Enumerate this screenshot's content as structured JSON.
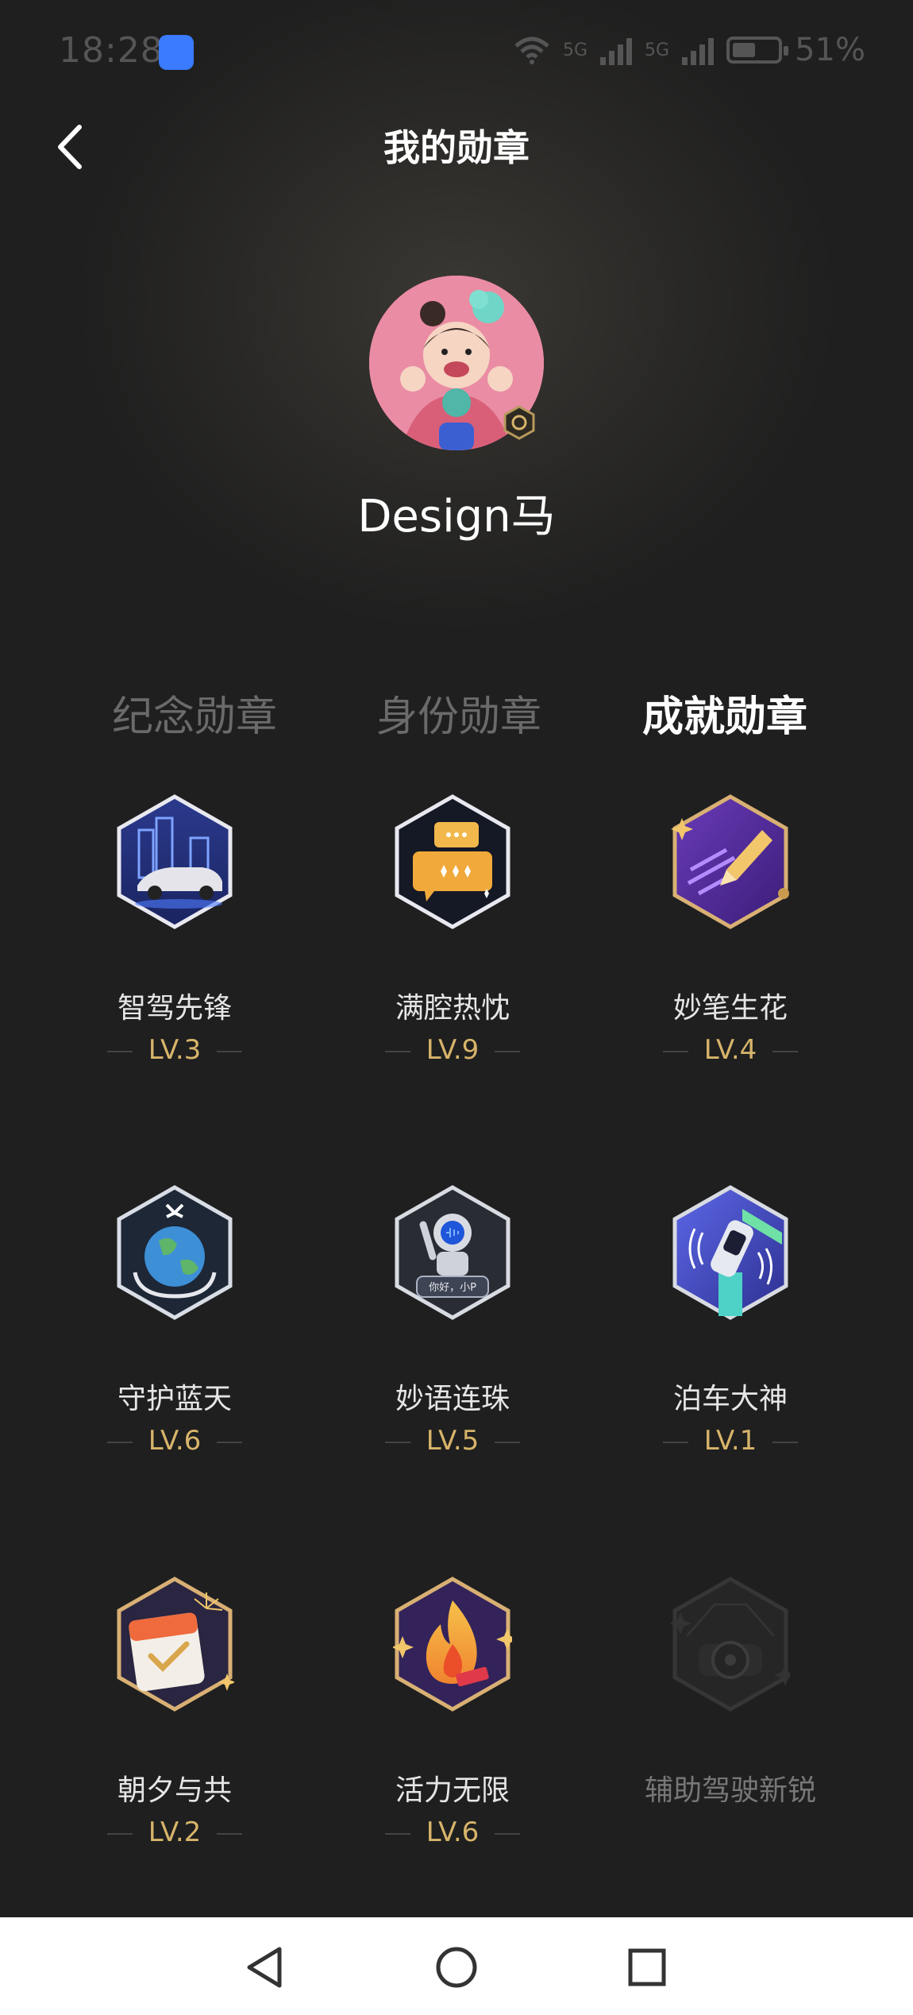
{
  "status_bar": {
    "time": "18:28",
    "network_1": "5G",
    "network_2": "5G",
    "battery": "51%"
  },
  "header": {
    "title": "我的勋章"
  },
  "profile": {
    "username": "Design马"
  },
  "tabs": [
    {
      "label": "纪念勋章",
      "active": false
    },
    {
      "label": "身份勋章",
      "active": false
    },
    {
      "label": "成就勋章",
      "active": true
    }
  ],
  "badges": [
    {
      "name": "智驾先锋",
      "level": "LV.3",
      "icon": "car-city-icon"
    },
    {
      "name": "满腔热忱",
      "level": "LV.9",
      "icon": "chat-bubbles-icon"
    },
    {
      "name": "妙笔生花",
      "level": "LV.4",
      "icon": "pencil-icon"
    },
    {
      "name": "守护蓝天",
      "level": "LV.6",
      "icon": "earth-hands-icon"
    },
    {
      "name": "妙语连珠",
      "level": "LV.5",
      "icon": "astronaut-icon",
      "inner_text": "你好，小P"
    },
    {
      "name": "泊车大神",
      "level": "LV.1",
      "icon": "parking-car-icon"
    },
    {
      "name": "朝夕与共",
      "level": "LV.2",
      "icon": "calendar-check-icon"
    },
    {
      "name": "活力无限",
      "level": "LV.6",
      "icon": "flame-icon"
    },
    {
      "name": "辅助驾驶新锐",
      "level": "",
      "icon": "steering-wheel-icon",
      "locked": true
    }
  ],
  "colors": {
    "gold": "#d7b46a",
    "background": "#1f1f1f",
    "nav_background": "#ffffff"
  }
}
